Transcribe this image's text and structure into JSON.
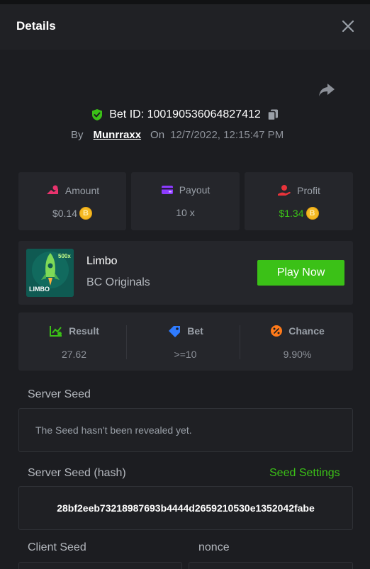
{
  "header": {
    "title": "Details"
  },
  "bet": {
    "id_text": "Bet ID: 100190536064827412",
    "by_label": "By",
    "user": "Munrraxx",
    "on_label": "On",
    "date": "12/7/2022, 12:15:47 PM"
  },
  "stats": {
    "amount": {
      "label": "Amount",
      "value": "$0.14"
    },
    "payout": {
      "label": "Payout",
      "value": "10 x"
    },
    "profit": {
      "label": "Profit",
      "value": "$1.34"
    },
    "coin_symbol": "B"
  },
  "game": {
    "name": "Limbo",
    "provider": "BC Originals",
    "play_label": "Play Now",
    "thumb_badge": "500x",
    "thumb_logo": "LIMBO"
  },
  "result": {
    "result": {
      "label": "Result",
      "value": "27.62"
    },
    "bet": {
      "label": "Bet",
      "value": ">=10"
    },
    "chance": {
      "label": "Chance",
      "value": "9.90%"
    }
  },
  "server_seed": {
    "label": "Server Seed",
    "value": "The Seed hasn't been revealed yet."
  },
  "server_seed_hash": {
    "label": "Server Seed (hash)",
    "settings_link": "Seed Settings",
    "value": "28bf2eeb73218987693b4444d2659210530e1352042fabe"
  },
  "client_seed": {
    "label": "Client Seed"
  },
  "nonce": {
    "label": "nonce"
  },
  "colors": {
    "accent_green": "#3bc117",
    "coin": "#f5b923",
    "amount_icon": "#e8336d",
    "payout_icon": "#8d3bff",
    "profit_icon": "#e8333a"
  }
}
